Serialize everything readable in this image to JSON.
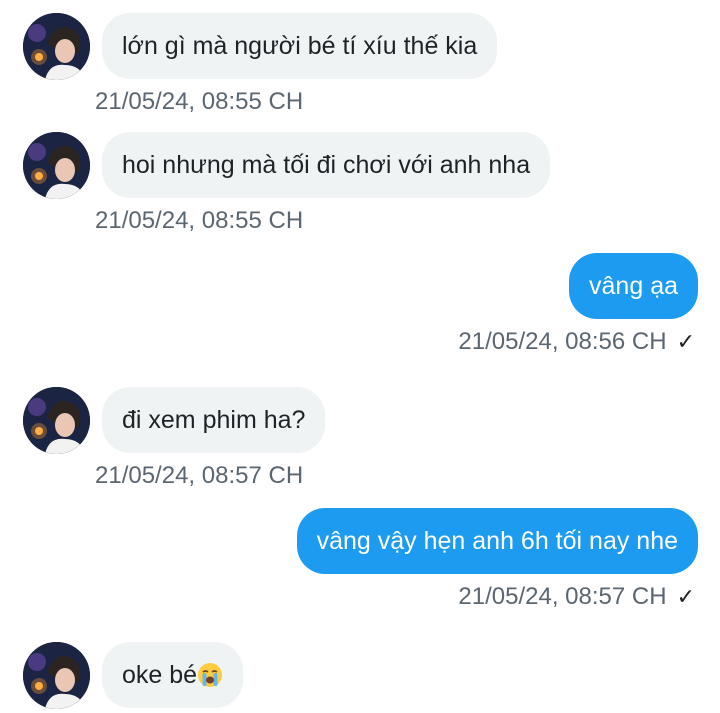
{
  "messages": [
    {
      "direction": "in",
      "text": "lớn gì mà người bé tí xíu thế kia",
      "timestamp": "21/05/24, 08:55 CH"
    },
    {
      "direction": "in",
      "text": "hoi nhưng mà tối đi chơi với anh nha",
      "timestamp": "21/05/24, 08:55 CH"
    },
    {
      "direction": "out",
      "text": "vâng ạa",
      "timestamp": "21/05/24, 08:56 CH",
      "status": "✓"
    },
    {
      "direction": "in",
      "text": "đi xem phim ha?",
      "timestamp": "21/05/24, 08:57 CH"
    },
    {
      "direction": "out",
      "text": "vâng vậy hẹn anh 6h tối nay nhe",
      "timestamp": "21/05/24, 08:57 CH",
      "status": "✓"
    },
    {
      "direction": "in",
      "text": "oke bé",
      "timestamp": "",
      "emoji": "loudly-crying-face-emoji"
    }
  ],
  "colors": {
    "incoming_bubble": "#eff3f4",
    "outgoing_bubble": "#1d9bf0",
    "timestamp_text": "#5b6670"
  }
}
